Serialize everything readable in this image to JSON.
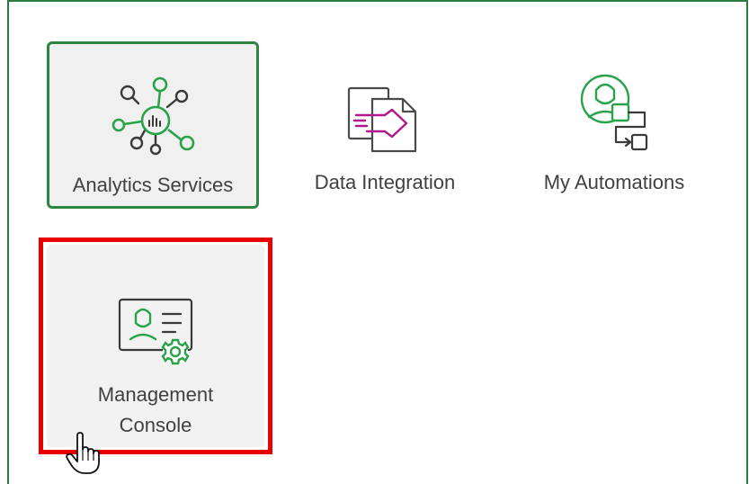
{
  "tiles": [
    {
      "label": "Analytics Services",
      "icon": "analytics-network-icon",
      "state": "selected"
    },
    {
      "label": "Data Integration",
      "icon": "data-integration-icon",
      "state": "default"
    },
    {
      "label": "My Automations",
      "icon": "automation-flow-icon",
      "state": "default"
    },
    {
      "label": "Management Console",
      "icon": "admin-gear-icon",
      "state": "highlighted"
    }
  ],
  "colors": {
    "accent_green": "#2e8540",
    "highlight_red": "#e60000",
    "integration_magenta": "#b0188c"
  },
  "cursor": {
    "icon": "hand-pointer-icon"
  }
}
